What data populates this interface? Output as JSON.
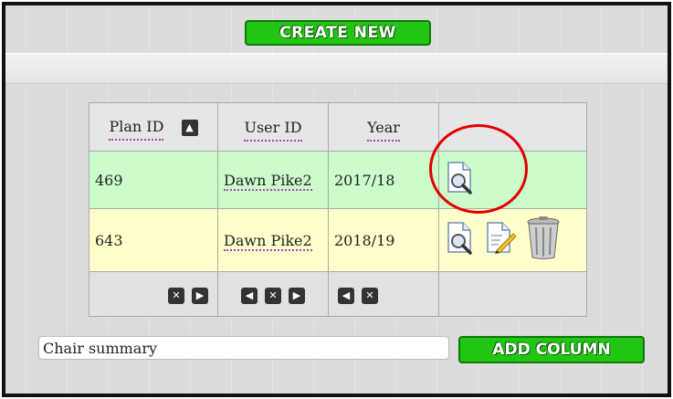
{
  "toolbar": {
    "create_label": "CREATE NEW"
  },
  "table": {
    "headers": {
      "plan_id": "Plan ID",
      "user_id": "User ID",
      "year": "Year",
      "sort_icon": "sort-up-icon"
    },
    "rows": [
      {
        "plan_id": "469",
        "user_id": "Dawn Pike2",
        "year": "2017/18",
        "actions": [
          "view-icon"
        ]
      },
      {
        "plan_id": "643",
        "user_id": "Dawn Pike2",
        "year": "2018/19",
        "actions": [
          "view-icon",
          "edit-icon",
          "delete-icon"
        ]
      }
    ],
    "filter_icons": {
      "plan_id": [
        "clear-icon",
        "next-icon"
      ],
      "user_id": [
        "prev-icon",
        "clear-icon",
        "next-icon"
      ],
      "year": [
        "prev-icon",
        "clear-icon"
      ]
    }
  },
  "footer": {
    "summary_value": "Chair summary",
    "add_column_label": "ADD COLUMN"
  },
  "colors": {
    "accent_green": "#22c514",
    "row_green": "#ccfccc",
    "row_yellow": "#ffffcc",
    "highlight_circle": "#e00000"
  }
}
